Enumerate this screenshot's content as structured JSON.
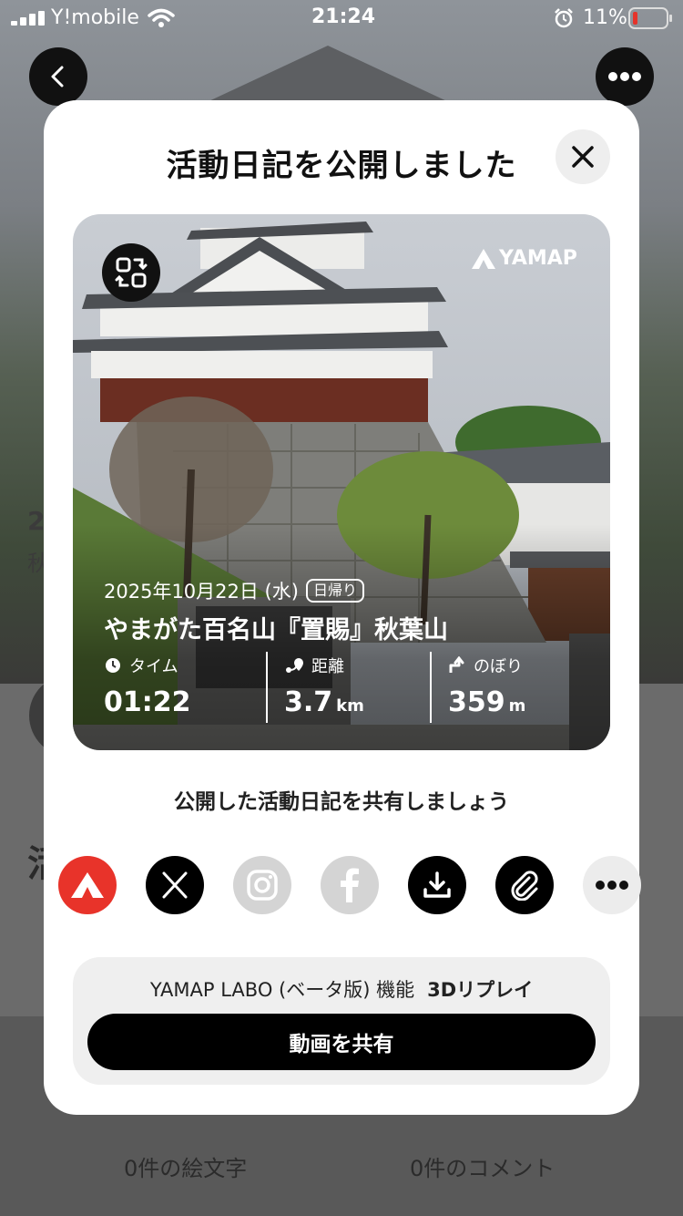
{
  "status_bar": {
    "carrier": "Y!mobile",
    "time": "21:24",
    "battery_percent": "11%",
    "icons": [
      "signal-icon",
      "wifi-icon",
      "alarm-icon",
      "battery-low-icon"
    ]
  },
  "background": {
    "stats_partial": "2",
    "name_partial": "秋",
    "section_partial": "活",
    "emoji_count": "0件の絵文字",
    "comment_count": "0件のコメント"
  },
  "nav": {
    "back_icon": "chevron-left-icon",
    "more_icon": "more-dots-icon"
  },
  "modal": {
    "title": "活動日記を公開しました",
    "close_icon": "close-icon",
    "card": {
      "brand": "YAMAP",
      "date": "2025年10月22日 (水)",
      "trip_type": "日帰り",
      "mountain": "やまがた百名山『置賜』秋葉山",
      "stats": [
        {
          "icon": "clock-icon",
          "label": "タイム",
          "value": "01:22",
          "unit": ""
        },
        {
          "icon": "route-icon",
          "label": "距離",
          "value": "3.7",
          "unit": "km"
        },
        {
          "icon": "ascent-icon",
          "label": "のぼり",
          "value": "359",
          "unit": "m"
        }
      ]
    },
    "share_prompt": "公開した活動日記を共有しましょう",
    "share_buttons": [
      {
        "name": "share-yamap-button",
        "icon": "yamap-icon",
        "color": "#e8332a"
      },
      {
        "name": "share-x-button",
        "icon": "x-icon",
        "color": "#000000"
      },
      {
        "name": "share-instagram-button",
        "icon": "instagram-icon",
        "color": "#d4d4d4"
      },
      {
        "name": "share-facebook-button",
        "icon": "facebook-icon",
        "color": "#d4d4d4"
      },
      {
        "name": "download-button",
        "icon": "download-icon",
        "color": "#000000"
      },
      {
        "name": "copy-link-button",
        "icon": "link-icon",
        "color": "#000000"
      },
      {
        "name": "share-more-button",
        "icon": "more-dots-icon",
        "color": "#ececec"
      }
    ],
    "labo": {
      "label": "YAMAP LABO (ベータ版) 機能",
      "feature": "3Dリプレイ",
      "button": "動画を共有"
    }
  }
}
